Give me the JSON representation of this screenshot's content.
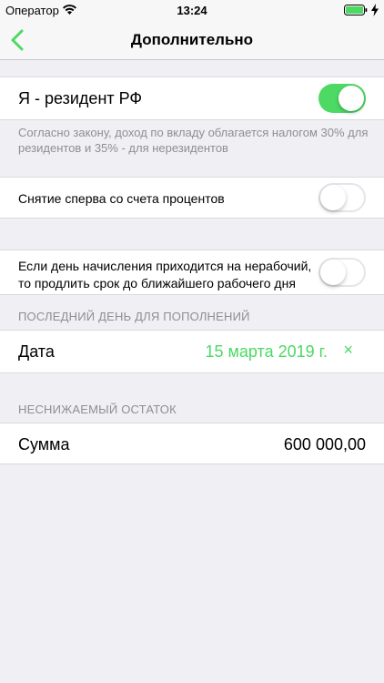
{
  "status_bar": {
    "carrier": "Оператор",
    "time": "13:24"
  },
  "nav": {
    "title": "Дополнительно"
  },
  "resident": {
    "label": "Я - резидент РФ",
    "enabled": true,
    "note": "Согласно закону, доход по вкладу облагается налогом 30% для резидентов и 35% - для нерезидентов"
  },
  "withdraw_interest": {
    "label": "Снятие сперва со счета процентов",
    "enabled": false
  },
  "non_working_day": {
    "label_line1": "Если день начисления приходится на нерабочий,",
    "label_line2": "то продлить срок до ближайшего рабочего дня",
    "enabled": false
  },
  "last_deposit_day": {
    "header": "ПОСЛЕДНИЙ ДЕНЬ ДЛЯ ПОПОЛНЕНИЙ",
    "label": "Дата",
    "value": "15 марта 2019 г.",
    "clear_symbol": "×"
  },
  "min_balance": {
    "header": "НЕСНИЖАЕМЫЙ ОСТАТОК",
    "label": "Сумма",
    "value": "600 000,00"
  },
  "colors": {
    "accent": "#4cd964",
    "tint": "#4cd964",
    "secondary_text": "#8e8e93",
    "background": "#efeff4"
  }
}
